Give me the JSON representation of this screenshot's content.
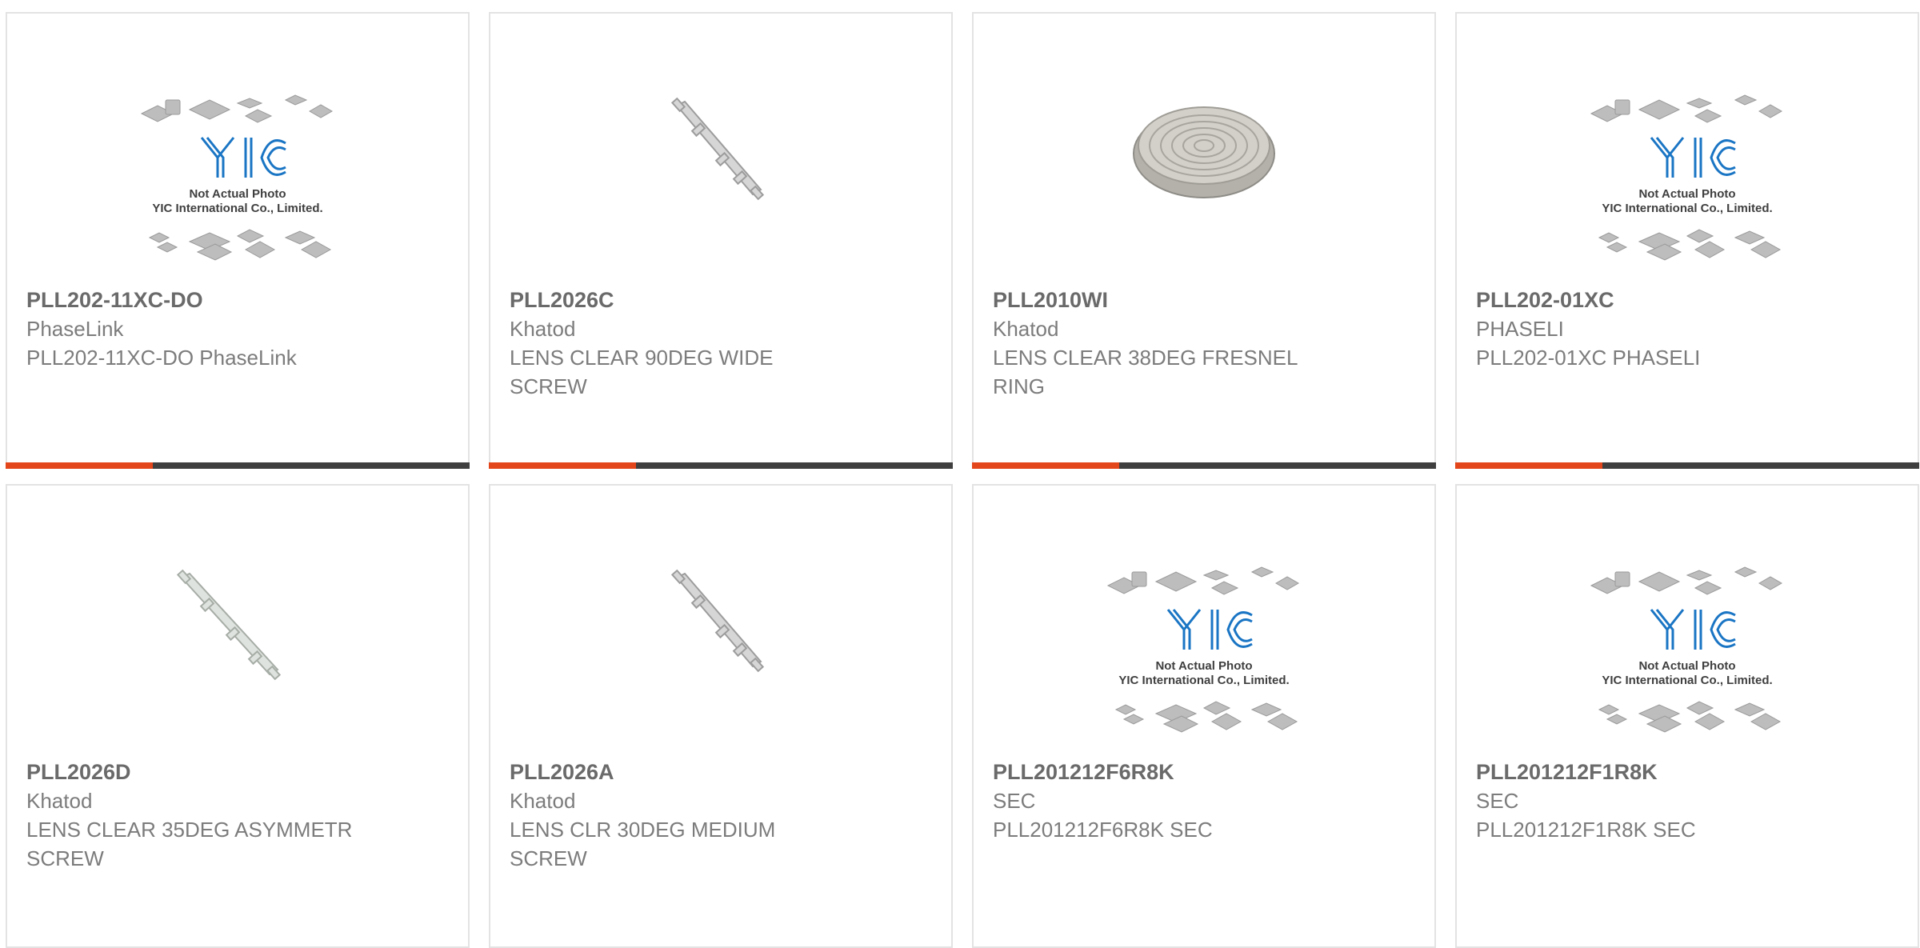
{
  "products": [
    {
      "part_number": "PLL202-11XC-DO",
      "manufacturer": "PhaseLink",
      "description": "PLL202-11XC-DO PhaseLink",
      "image": "yic-placeholder"
    },
    {
      "part_number": "PLL2026C",
      "manufacturer": "Khatod",
      "description": "LENS CLEAR 90DEG WIDE SCREW",
      "image": "lens-strip"
    },
    {
      "part_number": "PLL2010WI",
      "manufacturer": "Khatod",
      "description": "LENS CLEAR 38DEG FRESNEL RING",
      "image": "fresnel-lens"
    },
    {
      "part_number": "PLL202-01XC",
      "manufacturer": "PHASELI",
      "description": "PLL202-01XC PHASELI",
      "image": "yic-placeholder"
    },
    {
      "part_number": "PLL2026D",
      "manufacturer": "Khatod",
      "description": "LENS CLEAR 35DEG ASYMMETR SCREW",
      "image": "lens-strip"
    },
    {
      "part_number": "PLL2026A",
      "manufacturer": "Khatod",
      "description": "LENS CLR 30DEG MEDIUM SCREW",
      "image": "lens-strip"
    },
    {
      "part_number": "PLL201212F6R8K",
      "manufacturer": "SEC",
      "description": "PLL201212F6R8K SEC",
      "image": "yic-placeholder"
    },
    {
      "part_number": "PLL201212F1R8K",
      "manufacturer": "SEC",
      "description": "PLL201212F1R8K SEC",
      "image": "yic-placeholder"
    }
  ],
  "placeholder": {
    "logo_text": "YIC",
    "line1": "Not Actual Photo",
    "line2": "YIC International Co., Limited."
  },
  "colors": {
    "accent": "#e4461b",
    "bar": "#3f3f3f",
    "logo_blue": "#1a75c4",
    "text": "#7c7c7c",
    "part_number": "#6a6a6a"
  }
}
